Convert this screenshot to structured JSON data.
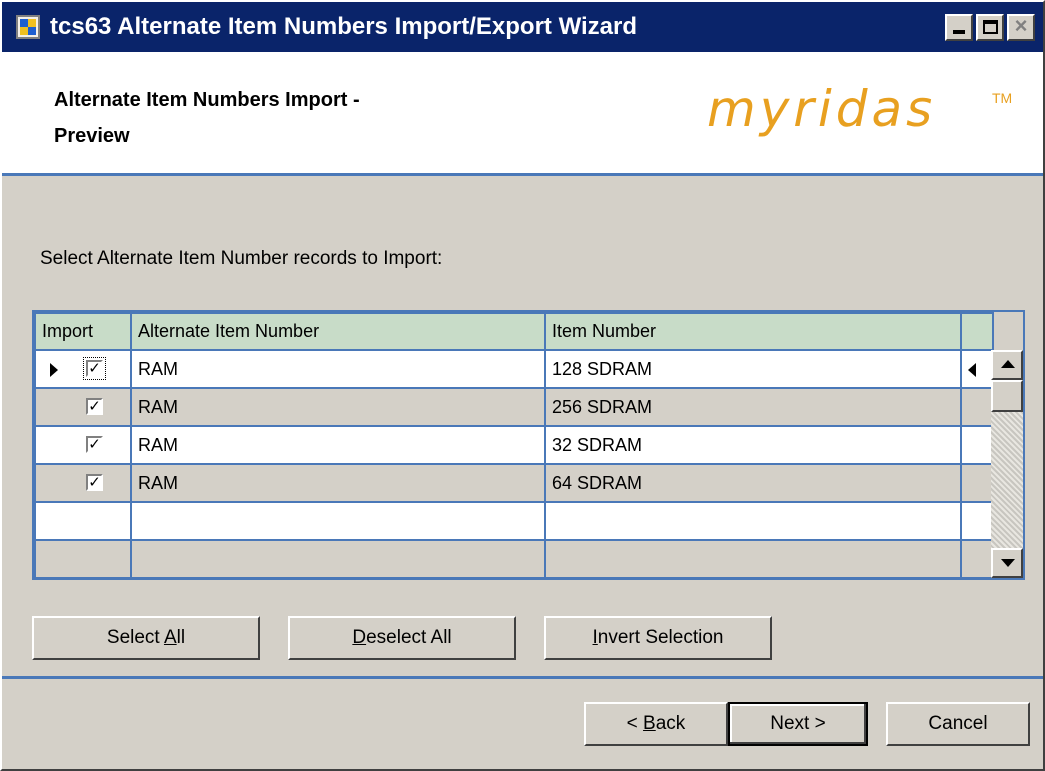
{
  "window": {
    "title": "tcs63 Alternate Item Numbers Import/Export Wizard",
    "accent_color": "#0a246a"
  },
  "header": {
    "title": "Alternate Item Numbers Import -",
    "title_line2": "Preview",
    "logo": "myridas",
    "logo_tm": "TM",
    "logo_color": "#e8a020"
  },
  "instruction": "Select Alternate Item Number records to Import:",
  "grid": {
    "columns": [
      "Import",
      "Alternate Item Number",
      "Item Number"
    ],
    "rows": [
      {
        "import": true,
        "alt": "RAM",
        "item": "128 SDRAM"
      },
      {
        "import": true,
        "alt": "RAM",
        "item": "256 SDRAM"
      },
      {
        "import": true,
        "alt": "RAM",
        "item": "32 SDRAM"
      },
      {
        "import": true,
        "alt": "RAM",
        "item": "64 SDRAM"
      }
    ],
    "check_glyph": "✓"
  },
  "selection_buttons": {
    "select_all_pre": "Select ",
    "select_all_acc": "A",
    "select_all_post": "ll",
    "deselect_all_acc": "D",
    "deselect_all_post": "eselect All",
    "invert_acc": "I",
    "invert_post": "nvert Selection"
  },
  "nav_buttons": {
    "back_pre": "< ",
    "back_acc": "B",
    "back_post": "ack",
    "next": "Next >",
    "cancel": "Cancel"
  }
}
